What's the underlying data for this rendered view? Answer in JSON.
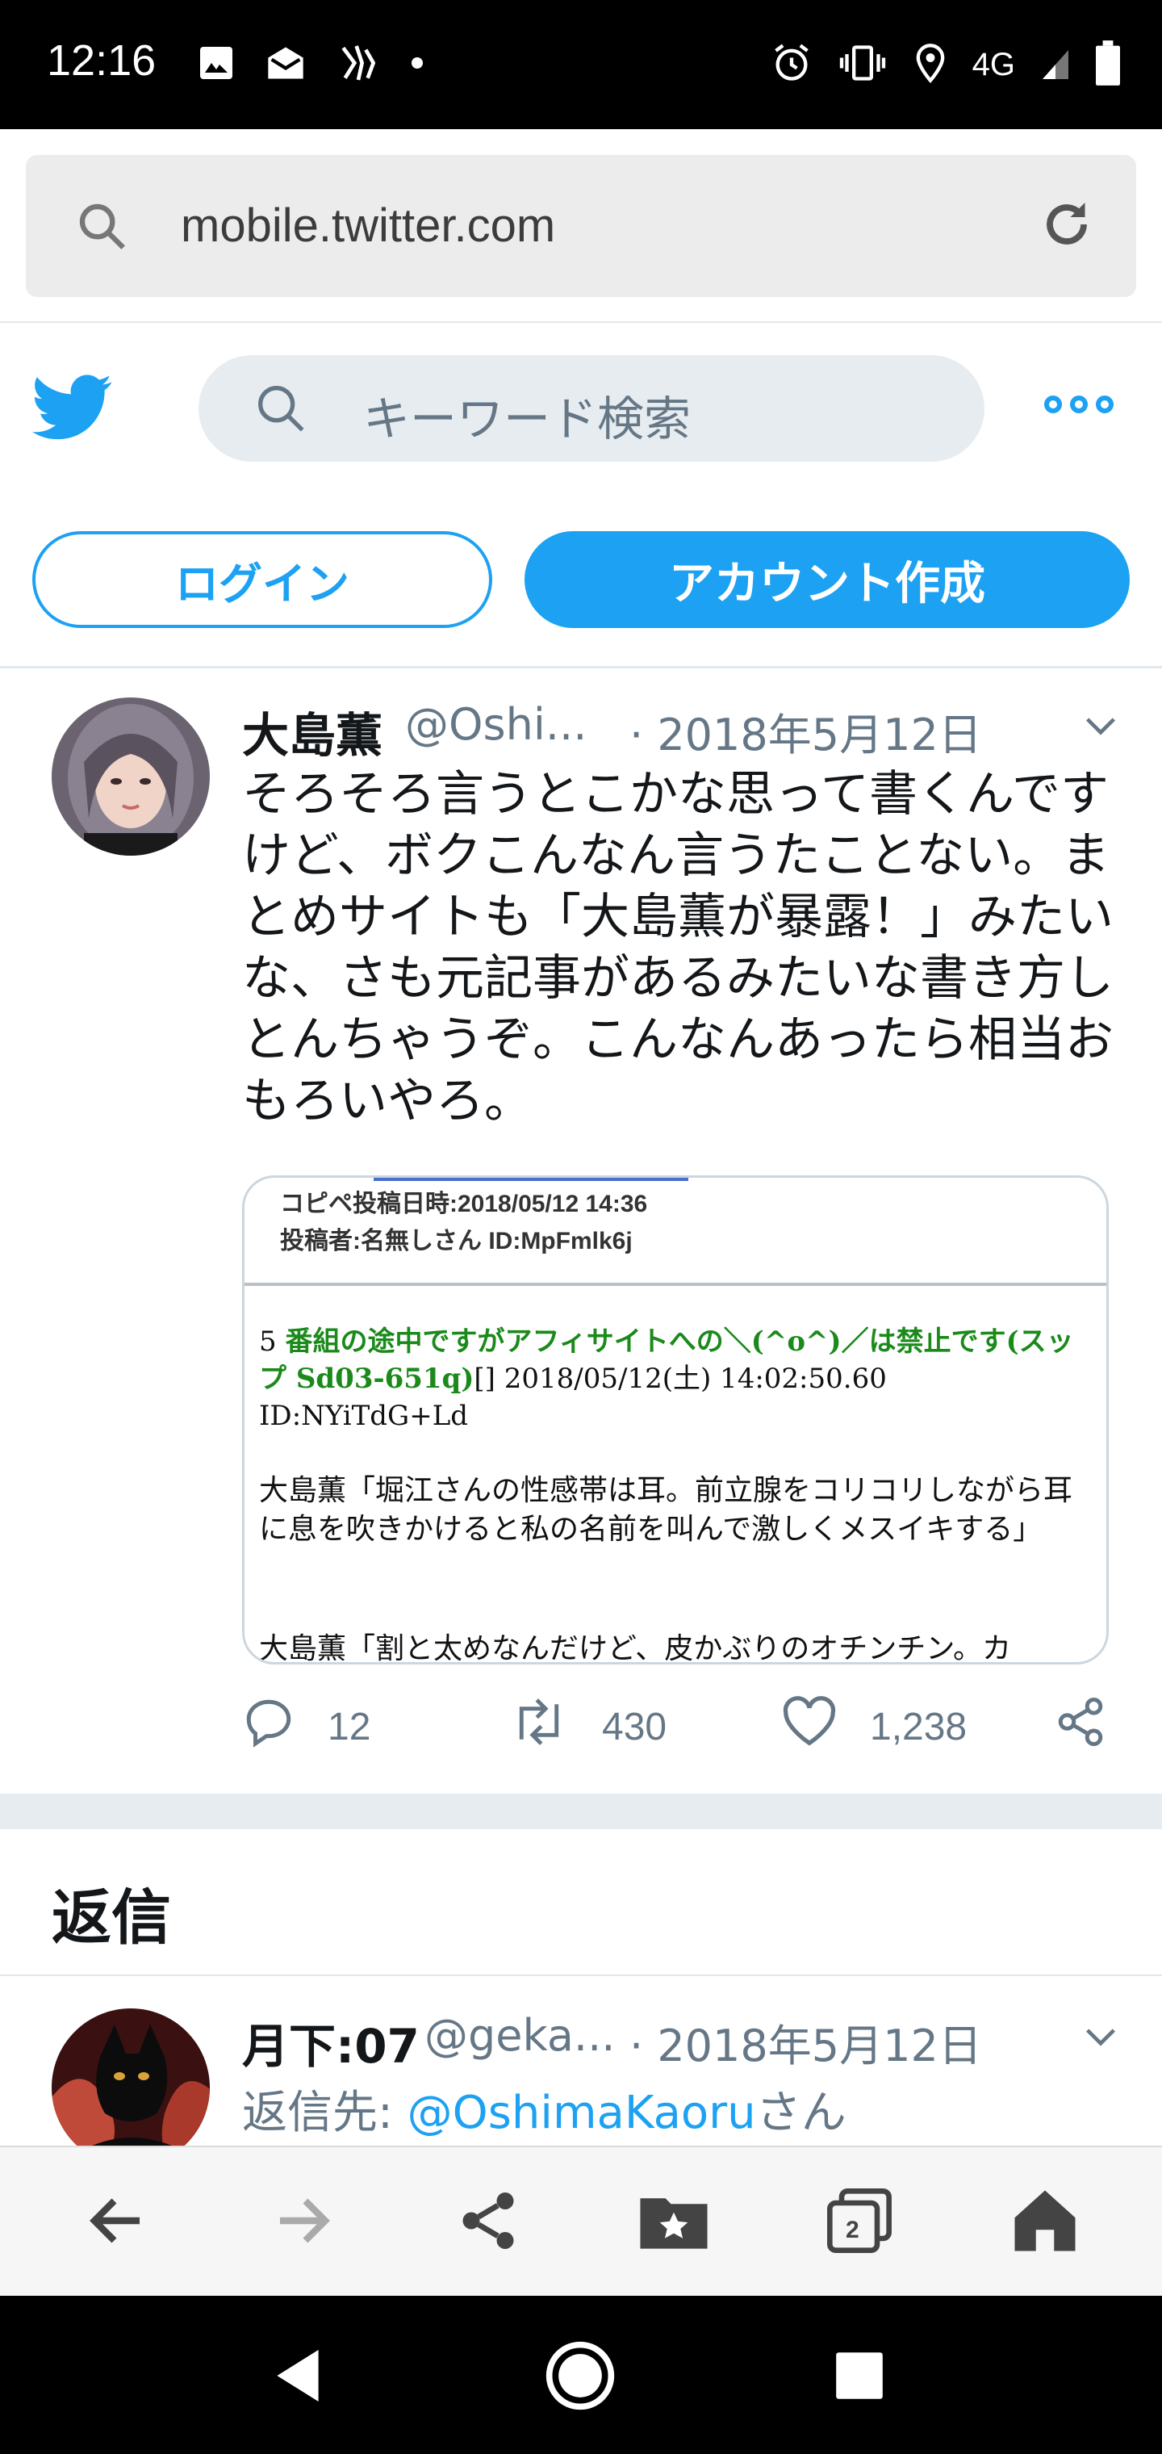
{
  "status_bar": {
    "time": "12:16",
    "network": "4G"
  },
  "browser": {
    "url": "mobile.twitter.com"
  },
  "twitter_header": {
    "search_placeholder": "キーワード検索",
    "login_label": "ログイン",
    "signup_label": "アカウント作成"
  },
  "tweet": {
    "author_name": "大島薫",
    "author_handle": "@Oshi...",
    "date": "· 2018年5月12日",
    "text": "そろそろ言うとこかな思って書くんですけど、ボクこんなん言うたことない。まとめサイトも「大島薫が暴露！」みたいな、さも元記事があるみたいな書き方しとんちゃうぞ。こんなんあったら相当おもろいやろ。",
    "media": {
      "meta_line1": "コピペ投稿日時:2018/05/12 14:36",
      "meta_line2": "投稿者:名無しさん  ID:MpFmlk6j",
      "post_number": "5 ",
      "post_name": "番組の途中ですがアフィサイトへの＼(^o^)／は禁止です(スップ Sd03-651q)",
      "post_meta": "[] 2018/05/12(土) 14:02:50.60 ID:NYiTdG+Ld",
      "post_body": "大島薫「堀江さんの性感帯は耳。前立腺をコリコリしながら耳に息を吹きかけると私の名前を叫んで激しくメスイキする」",
      "post_body2": "大島薫「割と太めなんだけど、皮かぶりのオチンチン。カ"
    },
    "replies": "12",
    "retweets": "430",
    "likes": "1,238"
  },
  "replies_section": {
    "title": "返信",
    "reply": {
      "author_name": "月下:07",
      "author_handle": "@geka...",
      "date": "· 2018年5月12日",
      "reply_to_label": "返信先: ",
      "reply_to_mention": "@OshimaKaoru",
      "reply_to_suffix": "さん"
    }
  },
  "bottom_bar": {
    "tab_count": "2"
  },
  "colors": {
    "twitter_blue": "#1da1f2",
    "muted": "#657786"
  }
}
